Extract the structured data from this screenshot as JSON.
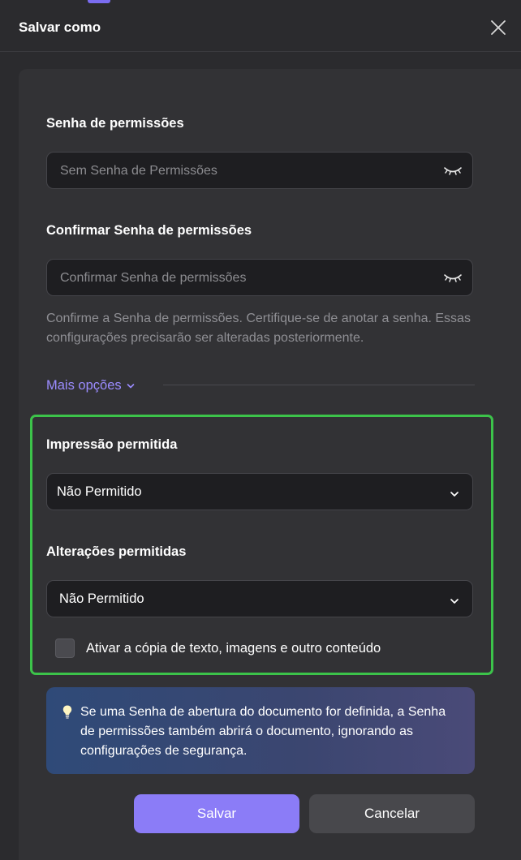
{
  "dialog": {
    "title": "Salvar como"
  },
  "permissions_password": {
    "label": "Senha de permissões",
    "placeholder": "Sem Senha de Permissões",
    "value": ""
  },
  "confirm_password": {
    "label": "Confirmar Senha de permissões",
    "placeholder": "Confirmar Senha de permissões",
    "value": ""
  },
  "hint": {
    "text": "Confirme a Senha de permissões. Certifique-se de anotar a senha. Essas configurações precisarão ser alteradas posteriormente."
  },
  "more_options": {
    "label": "Mais opções"
  },
  "printing": {
    "label": "Impressão permitida",
    "selected": "Não Permitido"
  },
  "changes": {
    "label": "Alterações permitidas",
    "selected": "Não Permitido"
  },
  "copy_content": {
    "label": "Ativar a cópia de texto, imagens e outro conteúdo",
    "checked": false
  },
  "info": {
    "icon": "lightbulb-icon",
    "text": "Se uma Senha de abertura do documento for definida, a Senha de permissões também abrirá o documento, ignorando as configurações de segurança."
  },
  "buttons": {
    "save": "Salvar",
    "cancel": "Cancelar"
  },
  "colors": {
    "accent": "#8b7cf7",
    "link": "#9b8cff",
    "highlight": "#3cc34a",
    "background": "#2b2b2e"
  }
}
